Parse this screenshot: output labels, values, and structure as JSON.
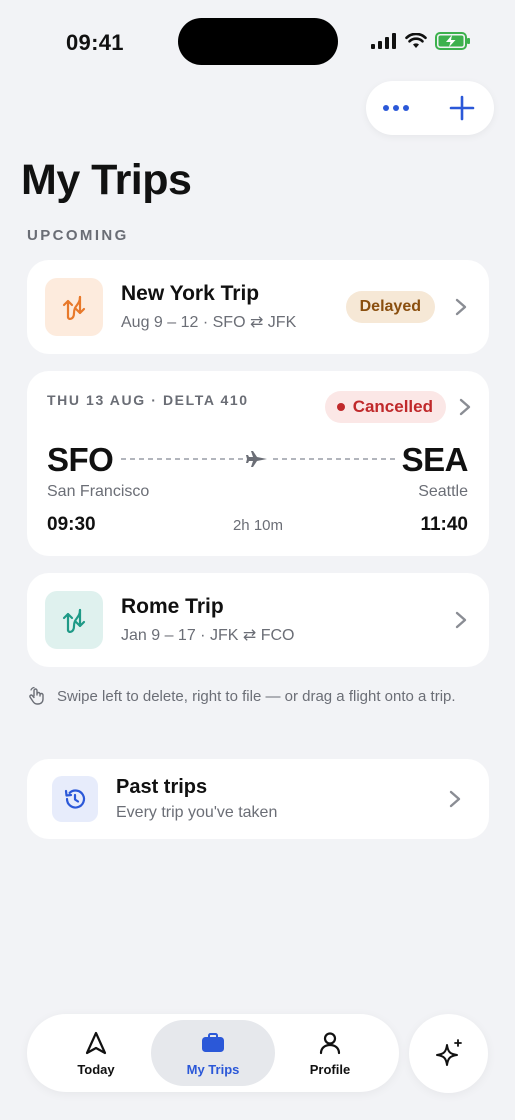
{
  "status": {
    "time": "09:41"
  },
  "page": {
    "title": "My Trips",
    "section_upcoming": "UPCOMING"
  },
  "trips": [
    {
      "title": "New York Trip",
      "dates": "Aug 9 – 12 · SFO ⇄ JFK",
      "badge": "Delayed",
      "icon": "route-icon",
      "accent": "#e8792b"
    },
    {
      "title": "Rome Trip",
      "dates": "Jan 9 – 17 · JFK ⇄ FCO",
      "icon": "route-icon",
      "accent": "#1f9a87"
    }
  ],
  "flight": {
    "header": "THU 13 AUG · DELTA 410",
    "status": "Cancelled",
    "from_code": "SFO",
    "to_code": "SEA",
    "from_city": "San Francisco",
    "to_city": "Seattle",
    "depart": "09:30",
    "arrive": "11:40",
    "duration": "2h 10m"
  },
  "hint": "Swipe left to delete, right to file — or drag a flight onto a trip.",
  "past": {
    "title": "Past trips",
    "subtitle": "Every trip you've taken"
  },
  "tabs": [
    {
      "label": "Today",
      "icon": "navigation-arrow-icon"
    },
    {
      "label": "My Trips",
      "icon": "briefcase-icon",
      "active": true
    },
    {
      "label": "Profile",
      "icon": "person-icon"
    }
  ],
  "colors": {
    "accent": "#2b58d8",
    "background": "#f2f3f6",
    "delayed": "#8a4f0f",
    "cancelled": "#c0292b"
  }
}
